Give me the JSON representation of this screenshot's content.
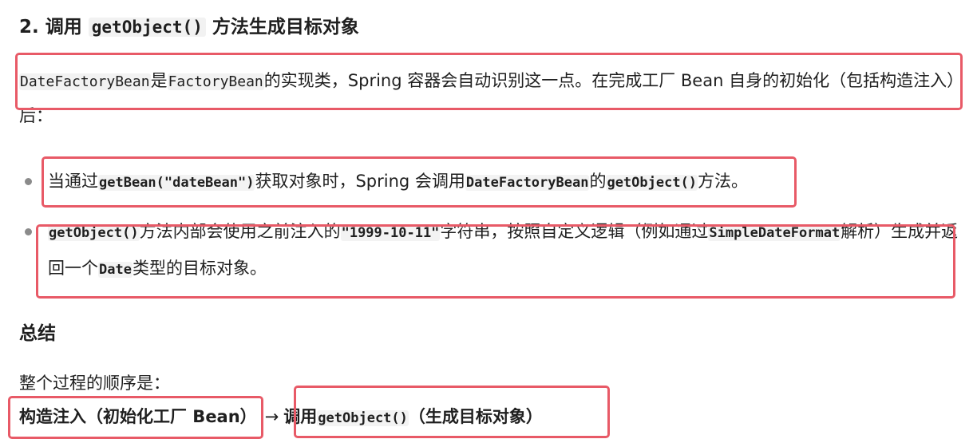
{
  "heading": {
    "prefix": "2. 调用 ",
    "code": "getObject()",
    "suffix": " 方法生成目标对象"
  },
  "paragraph": {
    "code1": "DateFactoryBean",
    "text1": "是",
    "code2": "FactoryBean",
    "text2": "的实现类，Spring 容器会自动识别这一点。在完成工厂 Bean 自身的初始化（包括构造注入）后："
  },
  "bullets": [
    {
      "text1": "当通过",
      "code1": "getBean(\"dateBean\")",
      "text2": "获取对象时，Spring 会调用",
      "code2": "DateFactoryBean",
      "text3": "的",
      "code3": "getObject()",
      "text4": "方法。"
    },
    {
      "code1": "getObject()",
      "text1": "方法内部会使用之前注入的",
      "code2": "\"1999-10-11\"",
      "text2": "字符串，按照自定义逻辑（例如通过",
      "code3": "SimpleDateFormat",
      "text3": "解析）生成并返回一个",
      "code4": "Date",
      "text4": "类型的目标对象。"
    }
  ],
  "summary": {
    "title": "总结",
    "intro": "整个过程的顺序是：",
    "step1": "构造注入（初始化工厂 Bean）",
    "arrow": "→",
    "step2_prefix": "调用",
    "step2_code": "getObject()",
    "step2_suffix": "（生成目标对象）"
  },
  "highlight_color": "#e85a67"
}
